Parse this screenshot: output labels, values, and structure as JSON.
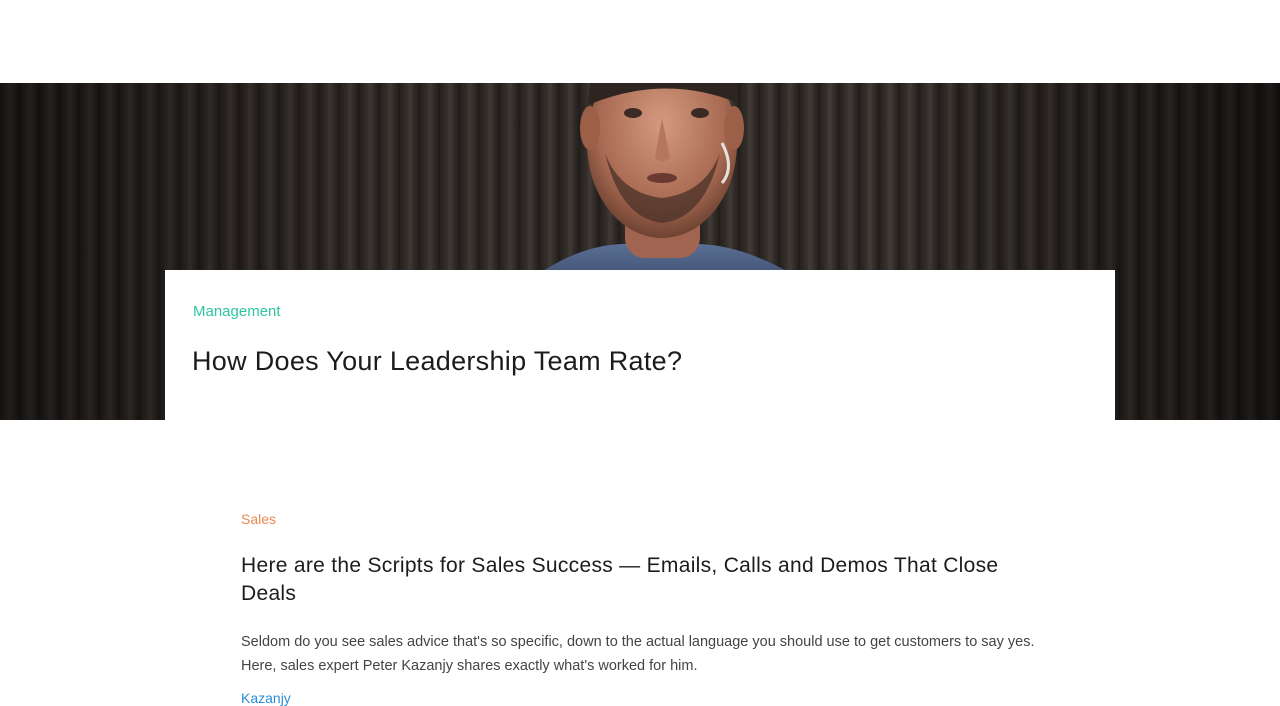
{
  "hero": {
    "image_alt": "speaker on stage",
    "category": "Management",
    "title": "How Does Your Leadership Team Rate?"
  },
  "article": {
    "category": "Sales",
    "title": "Here are the Scripts for Sales Success — Emails, Calls and Demos That Close Deals",
    "excerpt": "Seldom do you see sales advice that's so specific, down to the actual language you should use to get customers to say yes. Here, sales expert Peter Kazanjy shares exactly what's worked for him.",
    "author": "Kazanjy"
  },
  "colors": {
    "hero_category": "#2fc4a0",
    "article_category": "#e88a4f",
    "author_link": "#2a8fd6"
  }
}
